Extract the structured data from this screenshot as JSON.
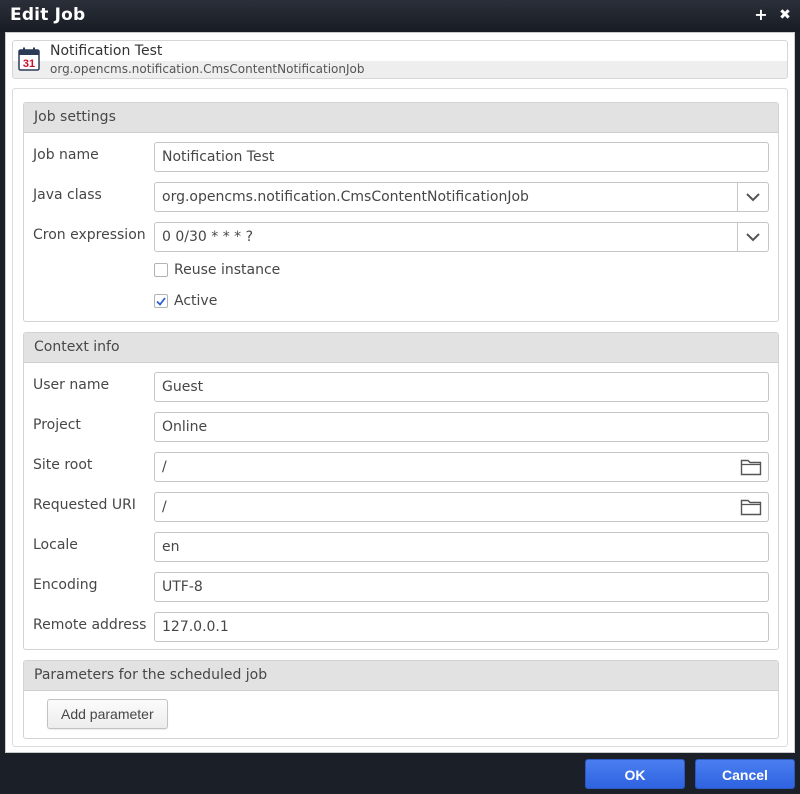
{
  "window": {
    "title": "Edit Job",
    "pin_glyph": "+",
    "close_glyph": "✖"
  },
  "info": {
    "icon": "calendar-icon",
    "calendar_day": "31",
    "title": "Notification Test",
    "subtitle": "org.opencms.notification.CmsContentNotificationJob"
  },
  "job_settings": {
    "header": "Job settings",
    "job_name_label": "Job name",
    "job_name_value": "Notification Test",
    "java_class_label": "Java class",
    "java_class_value": "org.opencms.notification.CmsContentNotificationJob",
    "cron_label": "Cron expression",
    "cron_value": "0 0/30 * * * ?",
    "reuse_label": "Reuse instance",
    "reuse_checked": false,
    "active_label": "Active",
    "active_checked": true
  },
  "context_info": {
    "header": "Context info",
    "user_name_label": "User name",
    "user_name_value": "Guest",
    "project_label": "Project",
    "project_value": "Online",
    "site_root_label": "Site root",
    "site_root_value": "/",
    "requested_uri_label": "Requested URI",
    "requested_uri_value": "/",
    "locale_label": "Locale",
    "locale_value": "en",
    "encoding_label": "Encoding",
    "encoding_value": "UTF-8",
    "remote_address_label": "Remote address",
    "remote_address_value": "127.0.0.1"
  },
  "parameters": {
    "header": "Parameters for the scheduled job",
    "add_button": "Add parameter"
  },
  "footer": {
    "ok_label": "OK",
    "cancel_label": "Cancel"
  },
  "colors": {
    "primary_button": "#3a6ee8",
    "panel_header": "#e2e2e2",
    "window_chrome": "#1b1f27",
    "calendar_red": "#c8102e"
  }
}
